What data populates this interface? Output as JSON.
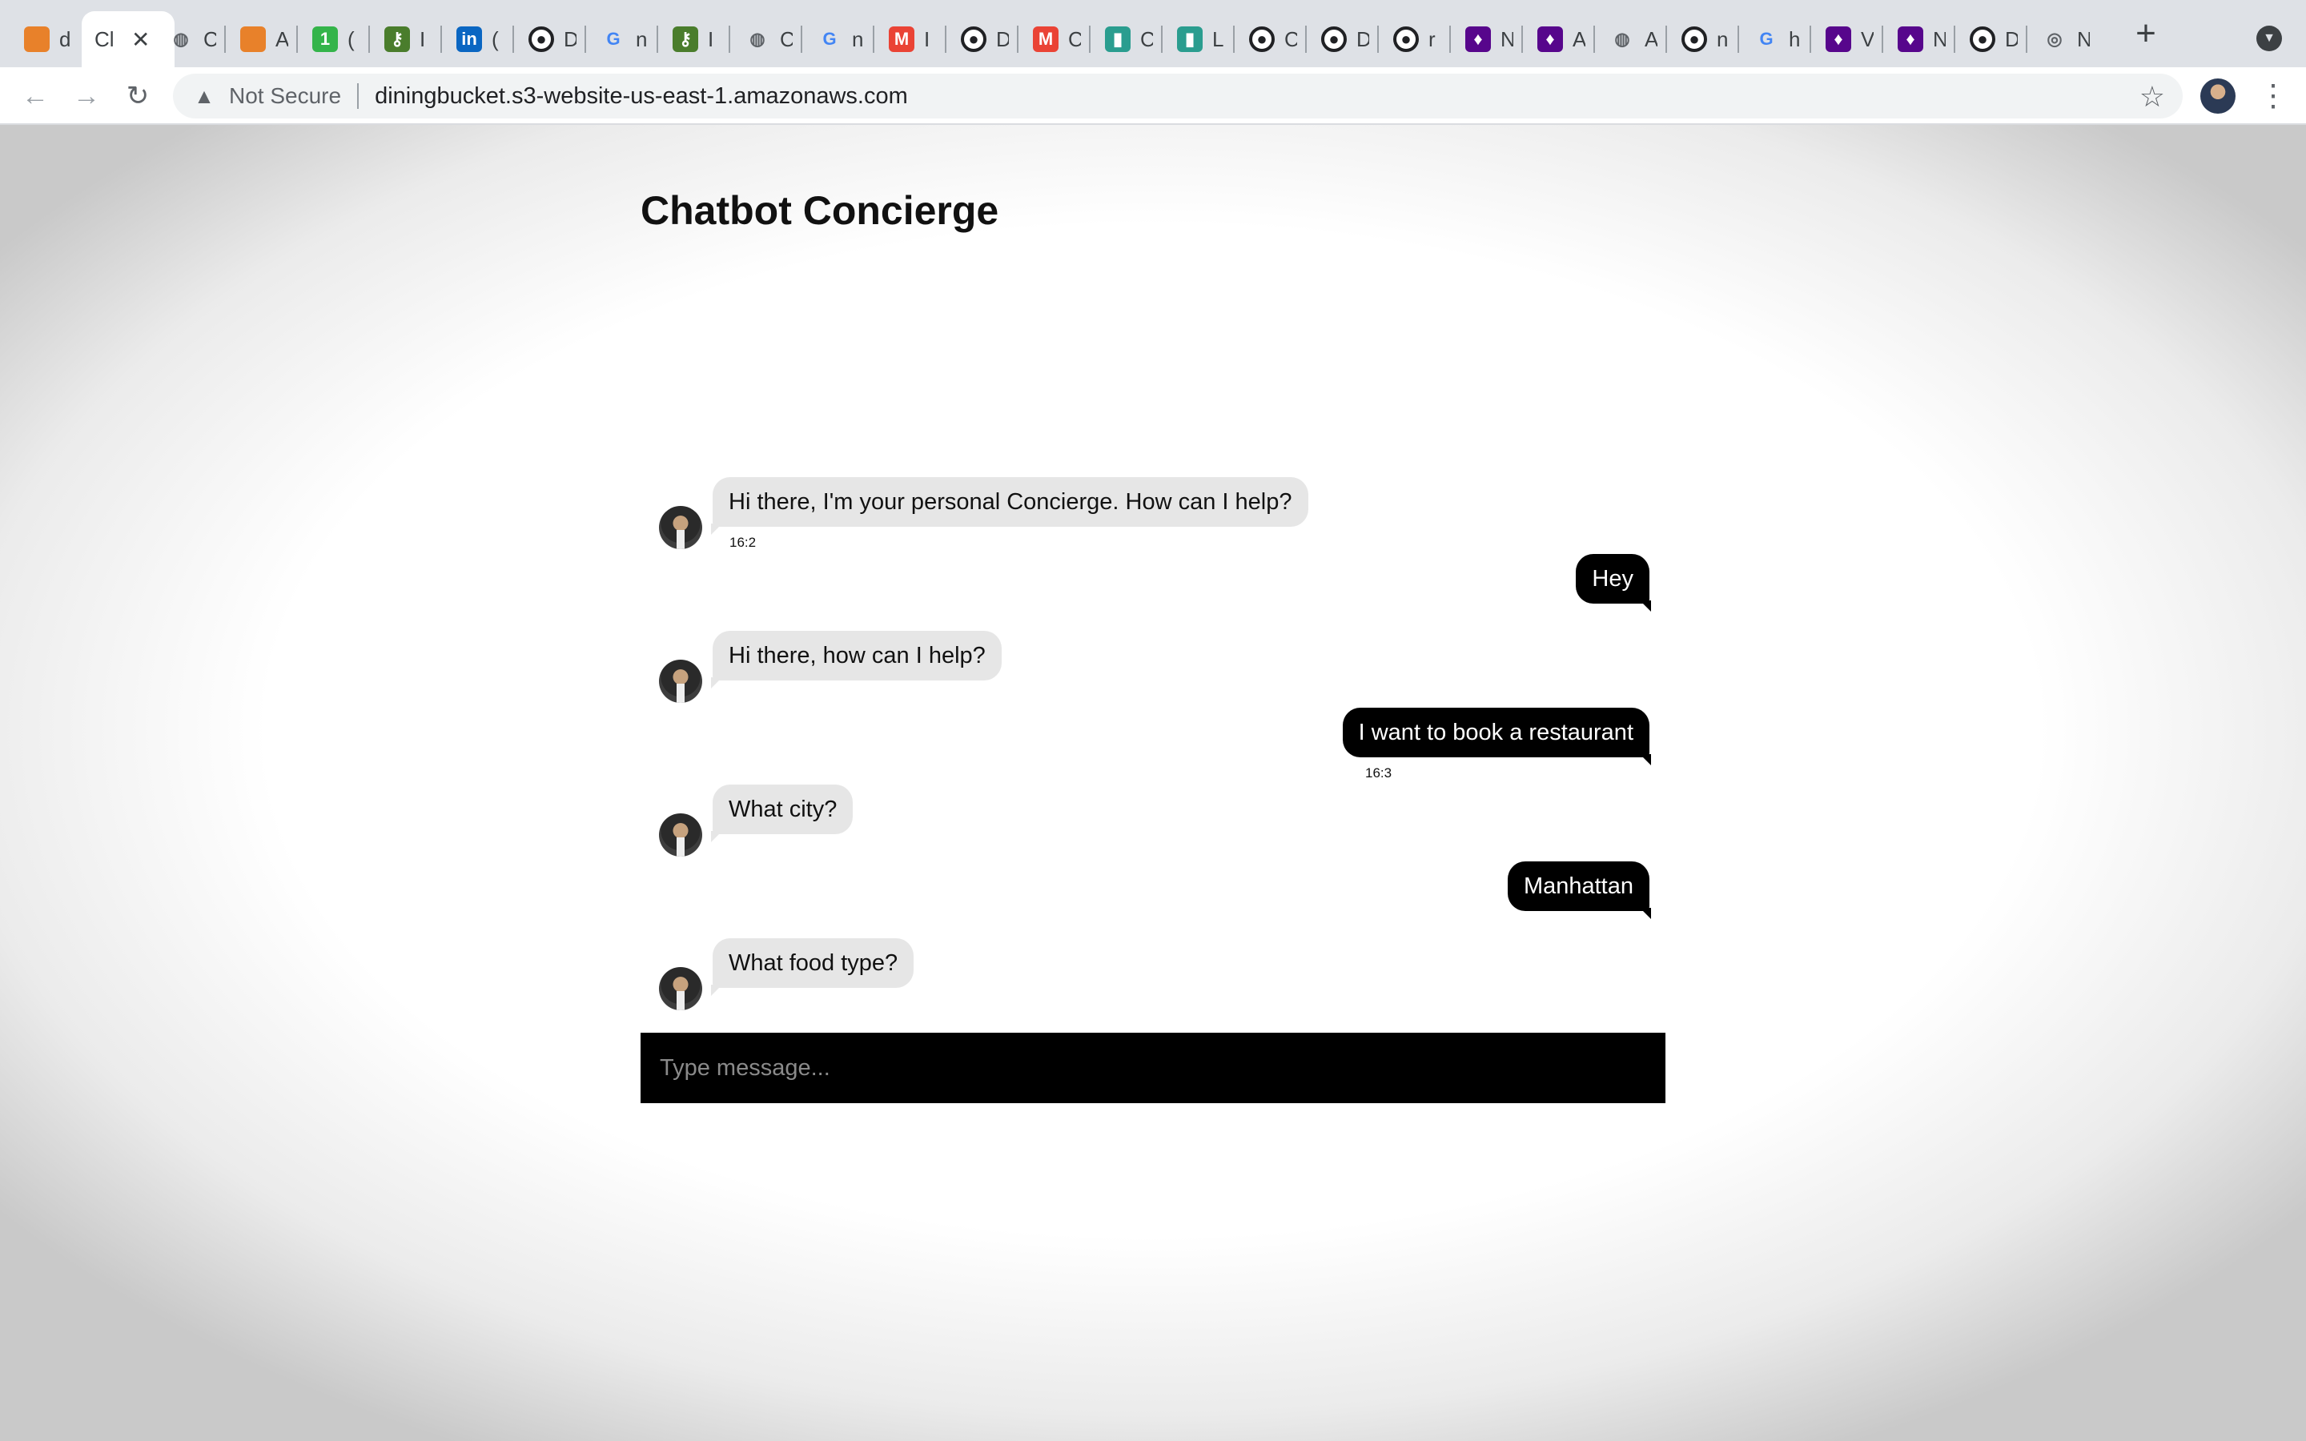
{
  "browser": {
    "tabs": [
      {
        "title": "d",
        "icon": "aws-box-icon",
        "color": "#e8812a",
        "glyph": ""
      },
      {
        "title": "Cl",
        "icon": "page-icon",
        "color": "#ffffff",
        "glyph": "",
        "active": true
      },
      {
        "title": "C",
        "icon": "globe-icon",
        "color": "#5f6368",
        "glyph": "◍"
      },
      {
        "title": "A",
        "icon": "aws-box-icon",
        "color": "#e8812a",
        "glyph": ""
      },
      {
        "title": "(",
        "icon": "whatsapp-icon",
        "color": "#34b44a",
        "glyph": "1"
      },
      {
        "title": "I",
        "icon": "key-icon",
        "color": "#4a7d2c",
        "glyph": "⚷"
      },
      {
        "title": "(",
        "icon": "linkedin-icon",
        "color": "#0a66c2",
        "glyph": "in"
      },
      {
        "title": "D",
        "icon": "github-icon",
        "color": "#202124",
        "glyph": "●"
      },
      {
        "title": "n",
        "icon": "google-icon",
        "color": "#4285f4",
        "glyph": "G"
      },
      {
        "title": "I",
        "icon": "key-icon",
        "color": "#4a7d2c",
        "glyph": "⚷"
      },
      {
        "title": "C",
        "icon": "globe-icon",
        "color": "#5f6368",
        "glyph": "◍"
      },
      {
        "title": "n",
        "icon": "google-icon",
        "color": "#4285f4",
        "glyph": "G"
      },
      {
        "title": "I",
        "icon": "gmail-icon",
        "color": "#ea4335",
        "glyph": "M"
      },
      {
        "title": "D",
        "icon": "github-icon",
        "color": "#202124",
        "glyph": "●"
      },
      {
        "title": "C",
        "icon": "gmail-icon",
        "color": "#ea4335",
        "glyph": "M"
      },
      {
        "title": "C",
        "icon": "analytics-icon",
        "color": "#2a9d8f",
        "glyph": "▮"
      },
      {
        "title": "L",
        "icon": "analytics-icon",
        "color": "#2a9d8f",
        "glyph": "▮"
      },
      {
        "title": "C",
        "icon": "github-icon",
        "color": "#202124",
        "glyph": "●"
      },
      {
        "title": "D",
        "icon": "github-icon",
        "color": "#202124",
        "glyph": "●"
      },
      {
        "title": "r",
        "icon": "github-icon",
        "color": "#202124",
        "glyph": "●"
      },
      {
        "title": "N",
        "icon": "nyu-icon",
        "color": "#57068c",
        "glyph": "♦"
      },
      {
        "title": "A",
        "icon": "nyu-icon",
        "color": "#57068c",
        "glyph": "♦"
      },
      {
        "title": "A",
        "icon": "globe-icon",
        "color": "#5f6368",
        "glyph": "◍"
      },
      {
        "title": "n",
        "icon": "github-icon",
        "color": "#202124",
        "glyph": "●"
      },
      {
        "title": "h",
        "icon": "google-icon",
        "color": "#4285f4",
        "glyph": "G"
      },
      {
        "title": "V",
        "icon": "nyu-icon",
        "color": "#57068c",
        "glyph": "♦"
      },
      {
        "title": "N",
        "icon": "nyu-icon",
        "color": "#57068c",
        "glyph": "♦"
      },
      {
        "title": "D",
        "icon": "github-icon",
        "color": "#202124",
        "glyph": "●"
      },
      {
        "title": "N",
        "icon": "chrome-icon",
        "color": "#5f6368",
        "glyph": "◎"
      }
    ],
    "security_status": "Not Secure",
    "url": "diningbucket.s3-website-us-east-1.amazonaws.com"
  },
  "page": {
    "title": "Chatbot Concierge",
    "messages": [
      {
        "from": "bot",
        "text": "Hi there, I'm your personal Concierge. How can I help?",
        "time": "16:2"
      },
      {
        "from": "user",
        "text": "Hey",
        "time": ""
      },
      {
        "from": "bot",
        "text": "Hi there, how can I help?",
        "time": ""
      },
      {
        "from": "user",
        "text": "I want to book a restaurant",
        "time": "16:3"
      },
      {
        "from": "bot",
        "text": "What city?",
        "time": ""
      },
      {
        "from": "user",
        "text": "Manhattan",
        "time": ""
      },
      {
        "from": "bot",
        "text": "What food type?",
        "time": ""
      }
    ],
    "composer_placeholder": "Type message..."
  }
}
